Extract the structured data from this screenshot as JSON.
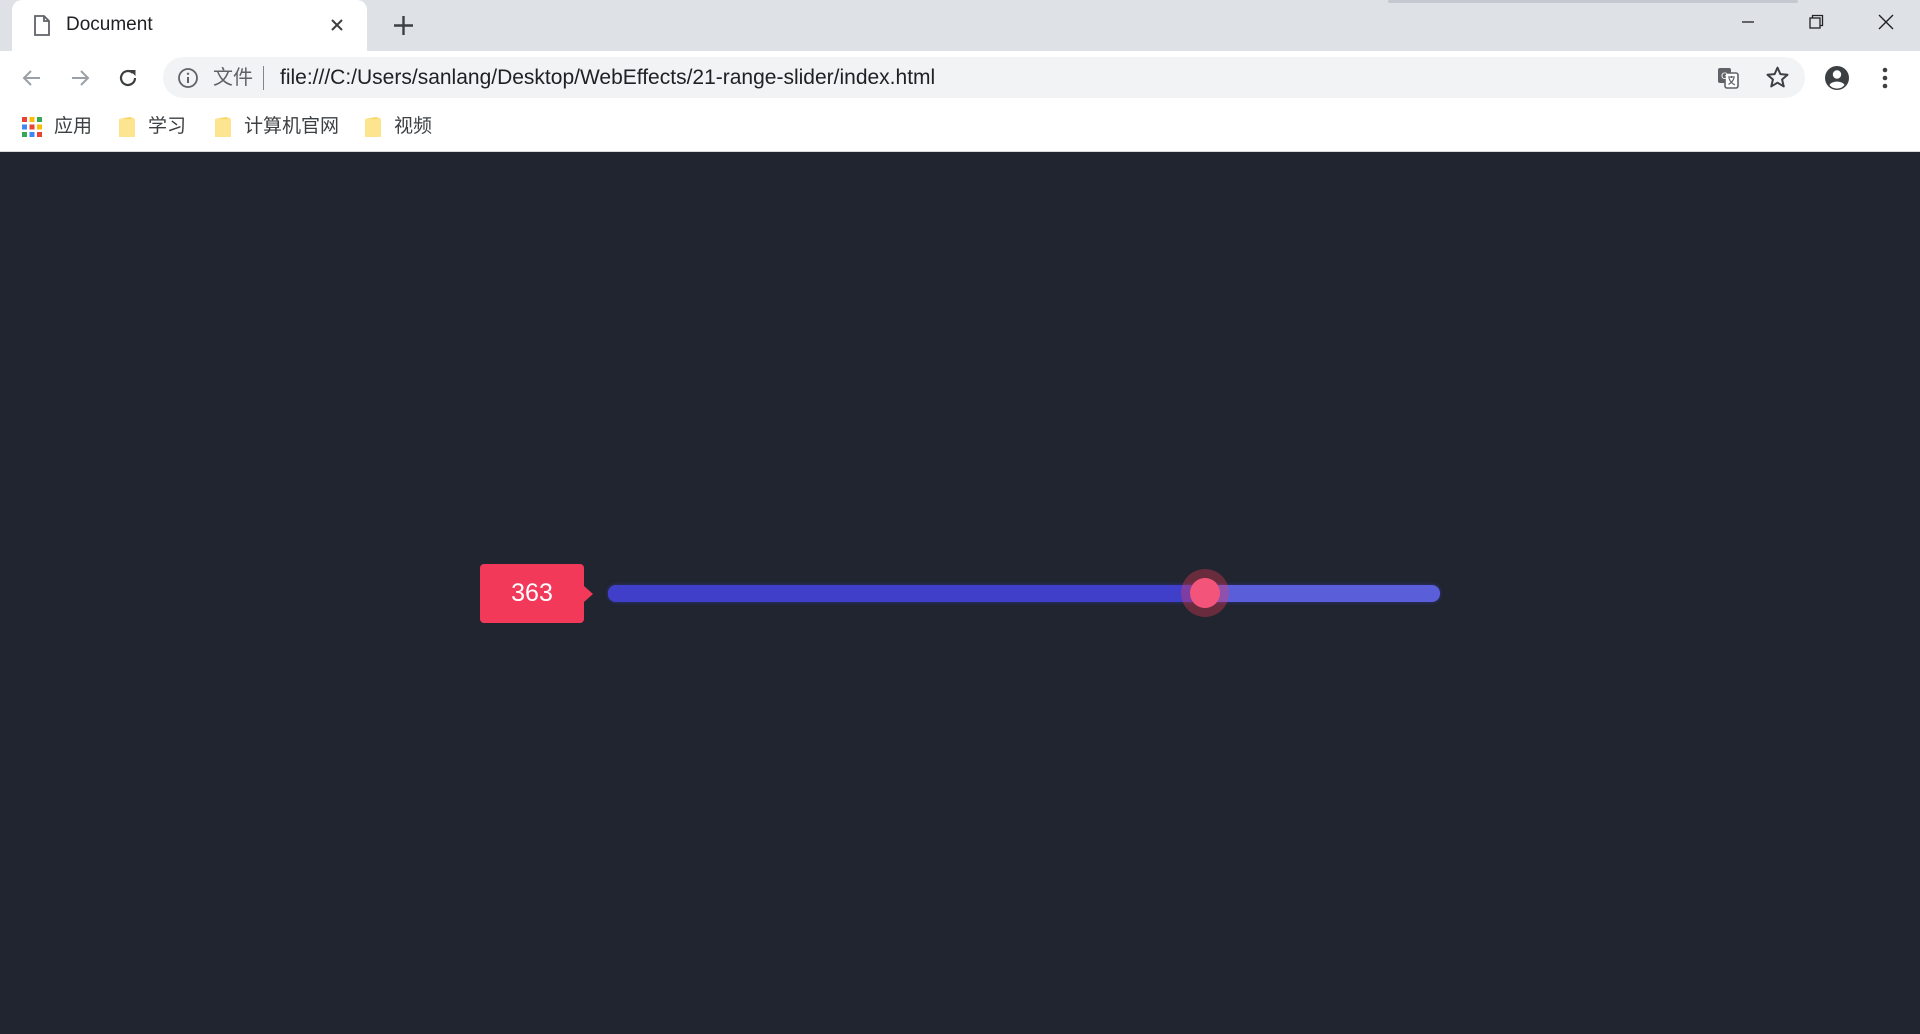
{
  "browser": {
    "tab": {
      "title": "Document"
    },
    "omnibox": {
      "scheme_label": "文件",
      "url": "file:///C:/Users/sanlang/Desktop/WebEffects/21-range-slider/index.html"
    },
    "bookmarks": [
      {
        "label": "应用",
        "icon": "apps-grid-icon"
      },
      {
        "label": "学习",
        "icon": "folder-icon"
      },
      {
        "label": "计算机官网",
        "icon": "folder-icon"
      },
      {
        "label": "视频",
        "icon": "folder-icon"
      }
    ]
  },
  "page": {
    "slider": {
      "value_label": "363",
      "fraction": 0.717,
      "colors": {
        "label_bg": "#f3395a",
        "track": "#5a5fd9",
        "track_fill": "#3f3fc9",
        "thumb": "#f3557a",
        "page_bg": "#20252f"
      }
    }
  }
}
